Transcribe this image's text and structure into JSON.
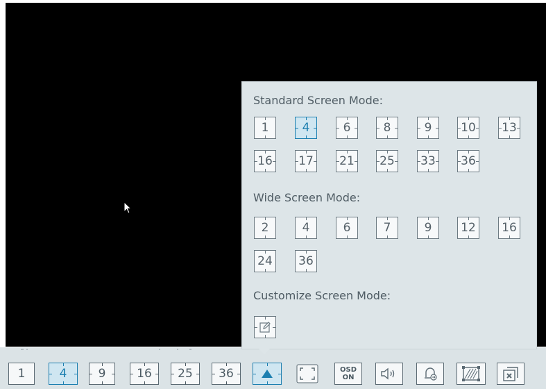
{
  "popup": {
    "standard_title": "Standard Screen Mode:",
    "standard_modes": [
      "1",
      "4",
      "6",
      "8",
      "9",
      "10",
      "13",
      "16",
      "17",
      "21",
      "25",
      "33",
      "36"
    ],
    "standard_active": "4",
    "wide_title": "Wide Screen Mode:",
    "wide_modes": [
      "2",
      "4",
      "6",
      "7",
      "9",
      "12",
      "16",
      "24",
      "36"
    ],
    "custom_title": "Customize Screen Mode:",
    "custom_icon": "edit-icon"
  },
  "toolbar": {
    "layouts": [
      "1",
      "4",
      "9",
      "16",
      "25",
      "36"
    ],
    "active_layout": "4",
    "osd_line1": "OSD",
    "osd_line2": "ON",
    "icons": [
      "screen-mode-toggle-icon",
      "fullscreen-icon",
      "osd-icon",
      "volume-icon",
      "alarm-icon",
      "aspect-icon",
      "close-window-icon"
    ]
  },
  "colors": {
    "accent": "#1c7fb0",
    "popup_bg": "#dde5e8",
    "bar_bg": "#dbe3e6",
    "video_bg": "#000000"
  }
}
